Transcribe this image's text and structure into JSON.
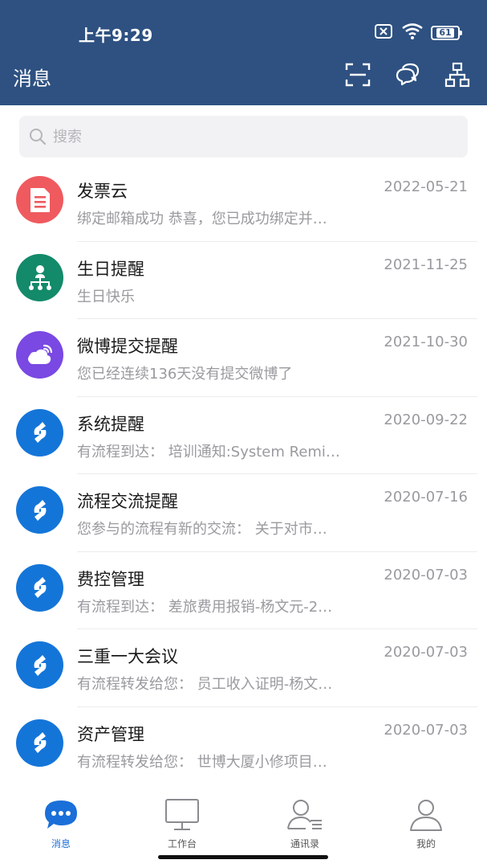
{
  "status_bar": {
    "time": "上午9:29",
    "battery": "61"
  },
  "header": {
    "title": "消息"
  },
  "search": {
    "placeholder": "搜索"
  },
  "messages": [
    {
      "name": "发票云",
      "date": "2022-05-21",
      "preview": "绑定邮箱成功 恭喜，您已成功绑定并…",
      "icon": "invoice-icon",
      "color": "#ef5a5f"
    },
    {
      "name": "生日提醒",
      "date": "2021-11-25",
      "preview": "生日快乐",
      "icon": "org-person-icon",
      "color": "#138a6a"
    },
    {
      "name": "微博提交提醒",
      "date": "2021-10-30",
      "preview": "您已经连续136天没有提交微博了",
      "icon": "weibo-icon",
      "color": "#7a48e3"
    },
    {
      "name": "系统提醒",
      "date": "2020-09-22",
      "preview": "有流程到达：  培训通知:System Remi…",
      "icon": "workflow-icon",
      "color": "#1475d9"
    },
    {
      "name": "流程交流提醒",
      "date": "2020-07-16",
      "preview": "您参与的流程有新的交流：  关于对市…",
      "icon": "workflow-icon",
      "color": "#1475d9"
    },
    {
      "name": "费控管理",
      "date": "2020-07-03",
      "preview": "有流程到达：  差旅费用报销-杨文元-2…",
      "icon": "workflow-icon",
      "color": "#1475d9"
    },
    {
      "name": "三重一大会议",
      "date": "2020-07-03",
      "preview": "有流程转发给您：  员工收入证明-杨文…",
      "icon": "workflow-icon",
      "color": "#1475d9"
    },
    {
      "name": "资产管理",
      "date": "2020-07-03",
      "preview": "有流程转发给您：  世博大厦小修项目…",
      "icon": "workflow-icon",
      "color": "#1475d9"
    }
  ],
  "tabs": [
    {
      "label": "消息",
      "icon": "chat-bubble-icon",
      "active": true
    },
    {
      "label": "工作台",
      "icon": "monitor-icon",
      "active": false
    },
    {
      "label": "通讯录",
      "icon": "contacts-icon",
      "active": false
    },
    {
      "label": "我的",
      "icon": "profile-icon",
      "active": false
    }
  ],
  "colors": {
    "header_bg": "#2e5181",
    "accent": "#1b6fd9"
  }
}
